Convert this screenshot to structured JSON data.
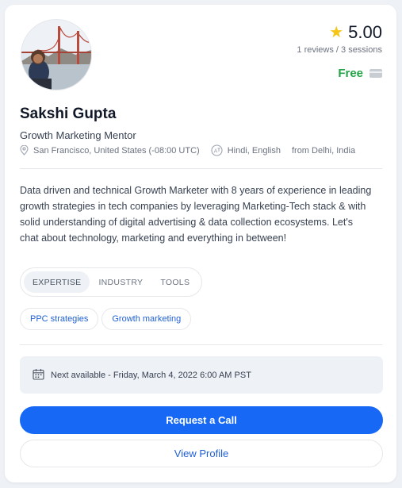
{
  "mentor": {
    "name": "Sakshi Gupta",
    "title": "Growth Marketing Mentor",
    "location": "San Francisco, United States (-08:00 UTC)",
    "languages": "Hindi, English",
    "origin": "from Delhi, India",
    "bio": "Data driven and technical Growth Marketer with 8 years of experience in leading growth strategies in tech companies by leveraging Marketing-Tech stack & with solid understanding of digital advertising & data collection ecosystems. Let's chat about technology, marketing and everything in between!"
  },
  "rating": {
    "value": "5.00",
    "summary": "1 reviews / 3 sessions"
  },
  "price": {
    "label": "Free"
  },
  "tabs": [
    {
      "label": "EXPERTISE",
      "active": true
    },
    {
      "label": "INDUSTRY",
      "active": false
    },
    {
      "label": "TOOLS",
      "active": false
    }
  ],
  "expertise_chips": [
    "PPC strategies",
    "Growth marketing"
  ],
  "availability": {
    "text": "Next available - Friday, March 4, 2022 6:00 AM PST"
  },
  "actions": {
    "primary": "Request a Call",
    "secondary": "View Profile"
  },
  "colors": {
    "accent": "#1668f5",
    "price_green": "#22a447",
    "star": "#f5c518"
  },
  "icons": {
    "rating": "star-icon",
    "price": "credit-card-icon",
    "location": "map-pin-icon",
    "language": "language-icon",
    "calendar": "calendar-icon"
  }
}
